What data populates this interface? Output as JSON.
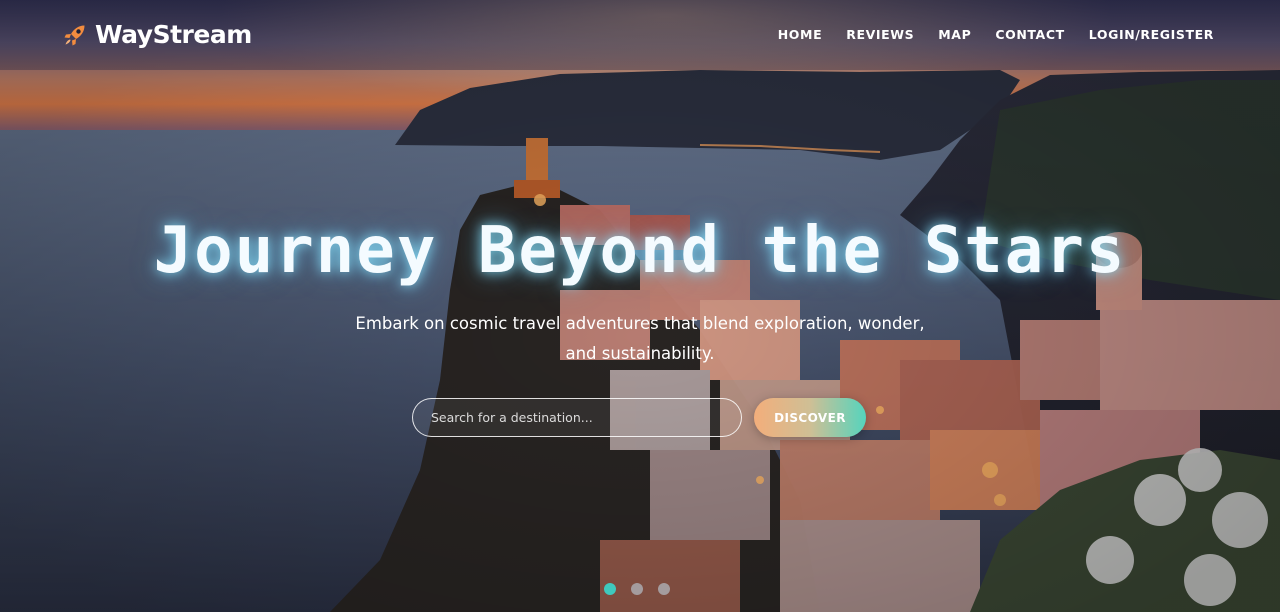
{
  "header": {
    "brand_name": "WayStream",
    "brand_icon": "rocket-icon",
    "brand_color": "#f28c3f",
    "nav": [
      {
        "label": "HOME"
      },
      {
        "label": "REVIEWS"
      },
      {
        "label": "MAP"
      },
      {
        "label": "CONTACT"
      },
      {
        "label": "LOGIN/REGISTER"
      }
    ]
  },
  "hero": {
    "title": "Journey Beyond the Stars",
    "subtitle": "Embark on cosmic travel adventures that blend exploration, wonder, and sustainability.",
    "search": {
      "placeholder": "Search for a destination...",
      "value": ""
    },
    "discover_label": "DISCOVER",
    "slides": {
      "count": 3,
      "active": 1
    }
  },
  "colors": {
    "accent_teal": "#3fc9bd",
    "accent_peach": "#f3ae7b",
    "title_glow": "#8ce6ff"
  }
}
